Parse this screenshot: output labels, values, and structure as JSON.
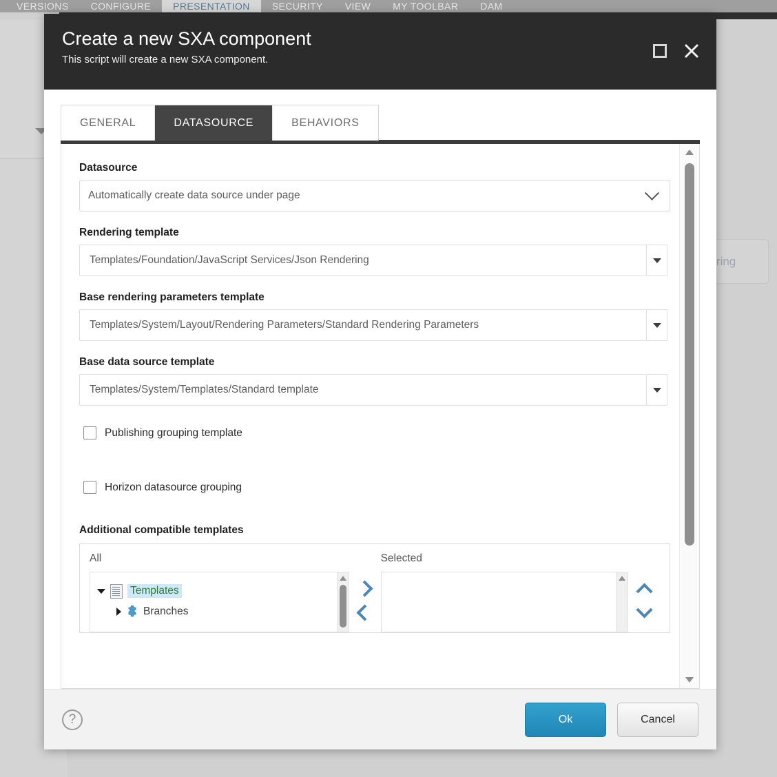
{
  "background": {
    "ribbon_tabs": [
      {
        "label": "VERSIONS",
        "active": false
      },
      {
        "label": "CONFIGURE",
        "active": false
      },
      {
        "label": "PRESENTATION",
        "active": true
      },
      {
        "label": "SECURITY",
        "active": false
      },
      {
        "label": "VIEW",
        "active": false
      },
      {
        "label": "MY TOOLBAR",
        "active": false
      },
      {
        "label": "DAM",
        "active": false
      }
    ],
    "obscured_button_label": "dering"
  },
  "dialog": {
    "title": "Create a new SXA component",
    "subtitle": "This script will create a new SXA component.",
    "maximize_icon": "maximize-icon",
    "close_icon": "close-icon",
    "tabs": [
      {
        "label": "GENERAL",
        "active": false
      },
      {
        "label": "DATASOURCE",
        "active": true
      },
      {
        "label": "BEHAVIORS",
        "active": false
      }
    ]
  },
  "form": {
    "datasource": {
      "label": "Datasource",
      "value": "Automatically create data source under page",
      "dropdown_icon": "chevron-down-icon"
    },
    "rendering_template": {
      "label": "Rendering template",
      "value": "Templates/Foundation/JavaScript Services/Json Rendering",
      "dropdown_icon": "triangle-down-icon"
    },
    "base_rendering_parameters_template": {
      "label": "Base rendering parameters template",
      "value": "Templates/System/Layout/Rendering Parameters/Standard Rendering Parameters",
      "dropdown_icon": "triangle-down-icon"
    },
    "base_data_source_template": {
      "label": "Base data source template",
      "value": "Templates/System/Templates/Standard template",
      "dropdown_icon": "triangle-down-icon"
    },
    "checkboxes": [
      {
        "label": "Publishing grouping template",
        "checked": false
      },
      {
        "label": "Horizon datasource grouping",
        "checked": false
      }
    ],
    "additional_compatible_templates": {
      "label": "Additional compatible templates",
      "all_heading": "All",
      "selected_heading": "Selected",
      "all_items": [
        {
          "label": "Templates",
          "level": 1,
          "expanded": true,
          "selected": true,
          "icon": "templates-document-icon"
        },
        {
          "label": "Branches",
          "level": 2,
          "expanded": false,
          "selected": false,
          "icon": "branches-puzzle-icon"
        }
      ],
      "selected_items": [],
      "move_right_icon": "chevron-right-icon",
      "move_left_icon": "chevron-left-icon",
      "move_up_icon": "chevron-up-icon",
      "move_down_icon": "chevron-down-icon"
    }
  },
  "footer": {
    "help_icon": "help-question-icon",
    "ok_label": "Ok",
    "cancel_label": "Cancel"
  },
  "colors": {
    "header_bg": "#2b2b2b",
    "active_tab_bg": "#444444",
    "primary_button": "#1f87b5",
    "tree_selected_text": "#2f7d32",
    "tree_selected_bg": "#cde8f6",
    "arrow_blue": "#4a87b8"
  }
}
